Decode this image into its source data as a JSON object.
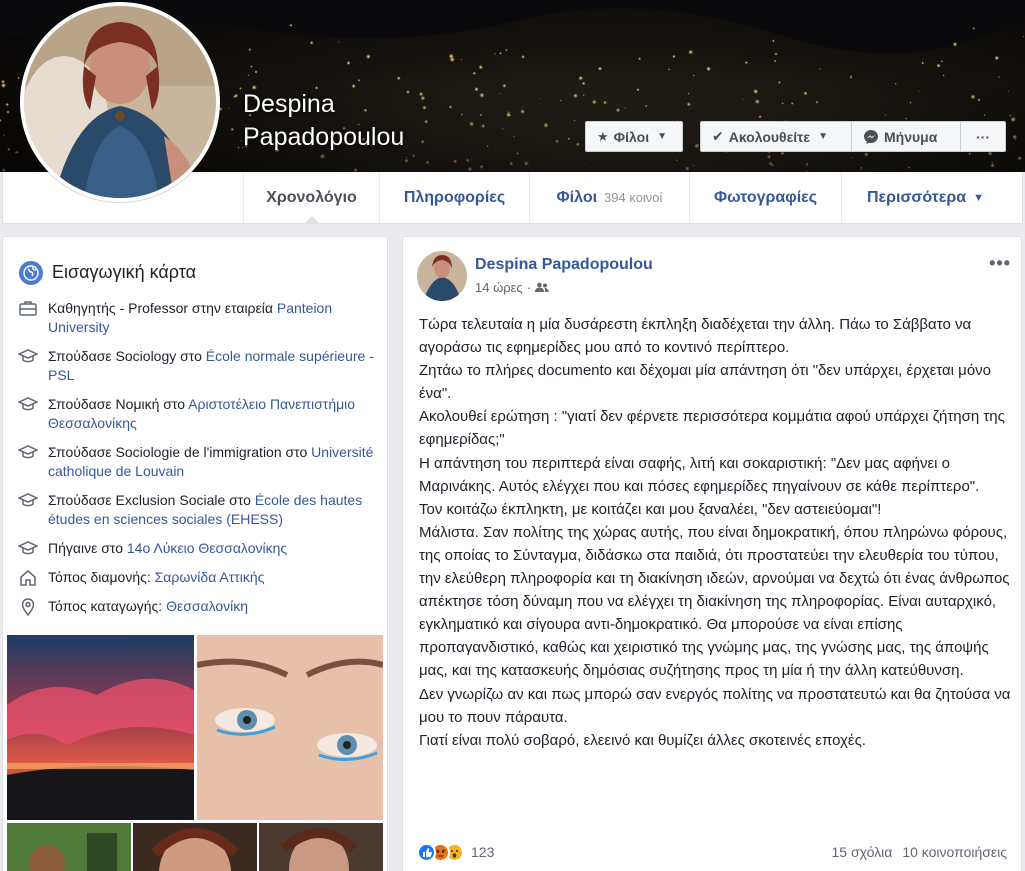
{
  "profile": {
    "name": "Despina Papadopoulou"
  },
  "cover_actions": {
    "friends_label": "Φίλοι",
    "follow_label": "Ακολουθείτε",
    "message_label": "Μήνυμα",
    "more_label": "···"
  },
  "nav": {
    "tabs": [
      {
        "label": "Χρονολόγιο"
      },
      {
        "label": "Πληροφορίες"
      },
      {
        "label": "Φίλοι",
        "count": "394 κοινοί"
      },
      {
        "label": "Φωτογραφίες"
      },
      {
        "label": "Περισσότερα"
      }
    ]
  },
  "intro": {
    "title": "Εισαγωγική κάρτα",
    "items": [
      {
        "icon": "briefcase-icon",
        "text": "Καθηγητής - Professor στην εταιρεία ",
        "link": "Panteion University"
      },
      {
        "icon": "graduation-cap-icon",
        "text": "Σπούδασε Sociology στο ",
        "link": "École normale supérieure - PSL"
      },
      {
        "icon": "graduation-cap-icon",
        "text": "Σπούδασε Νομική στο ",
        "link": "Αριστοτέλειο Πανεπιστήμιο Θεσσαλονίκης"
      },
      {
        "icon": "graduation-cap-icon",
        "text": "Σπούδασε Sociologie de l'immigration στο ",
        "link": "Université catholique de Louvain"
      },
      {
        "icon": "graduation-cap-icon",
        "text": "Σπούδασε Exclusion Sociale στο ",
        "link": "École des hautes études en sciences sociales (EHESS)"
      },
      {
        "icon": "graduation-cap-icon",
        "text": "Πήγαινε στο ",
        "link": "14ο Λύκειο Θεσσαλονίκης"
      },
      {
        "icon": "home-icon",
        "text": "Τόπος διαμονής: ",
        "link": "Σαρωνίδα Αττικής"
      },
      {
        "icon": "location-pin-icon",
        "text": "Τόπος καταγωγής: ",
        "link": "Θεσσαλονίκη"
      }
    ]
  },
  "post": {
    "author": "Despina Papadopoulou",
    "time": "14 ώρες",
    "audience_icon": "friends-icon",
    "paragraphs": [
      "Τώρα τελευταία η μία δυσάρεστη έκπληξη διαδέχεται την άλλη. Πάω το Σάββατο να αγοράσω τις εφημερίδες μου από το κοντινό περίπτερο.",
      "Ζητάω το πλήρες documento και δέχομαι μία απάντηση ότι \"δεν υπάρχει, έρχεται μόνο ένα\".",
      "Ακολουθεί ερώτηση : \"γιατί δεν φέρνετε περισσότερα κομμάτια αφού υπάρχει ζήτηση της εφημερίδας;\"",
      "Η απάντηση του περιπτερά είναι σαφής, λιτή και σοκαριστική: \"Δεν μας αφήνει ο Μαρινάκης. Αυτός ελέγχει που και πόσες εφημερίδες πηγαίνουν σε κάθε περίπτερο\".",
      "Τον κοιτάζω έκπληκτη, με κοιτάζει και μου ξαναλέει, \"δεν αστειεύομαι\"!",
      "Μάλιστα. Σαν πολίτης της χώρας αυτής, που είναι δημοκρατική, όπου πληρώνω φόρους, της οποίας το Σύνταγμα, διδάσκω στα παιδιά, ότι προστατεύει την ελευθερία του τύπου, την ελεύθερη πληροφορία και τη διακίνηση ιδεών, αρνούμαι να δεχτώ ότι ένας άνθρωπος απέκτησε τόση δύναμη που να ελέγχει τη διακίνηση της πληροφορίας. Είναι αυταρχικό, εγκληματικό και σίγουρα αντι-δημοκρατικό. Θα μπορούσε να είναι επίσης προπαγανδιστικό, καθώς και χειριστικό της γνώμης μας, της γνώσης μας, της άποψής μας, και της κατασκευής δημόσιας συζήτησης προς τη μία ή την άλλη κατεύθυνση.",
      "Δεν γνωρίζω αν και πως μπορώ σαν ενεργός πολίτης να προστατευτώ και θα ζητούσα να μου το πουν πάραυτα.",
      "Γιατί είναι πολύ σοβαρό, ελεεινό και θυμίζει άλλες σκοτεινές εποχές."
    ],
    "reactions": {
      "icons": [
        "like-icon",
        "angry-icon",
        "wow-icon"
      ],
      "count": "123"
    },
    "comments": "15 σχόλια",
    "shares": "10 κοινοποιήσεις",
    "menu_label": "•••"
  },
  "colors": {
    "link": "#365899",
    "like": "#1877f2",
    "angry": "#e9710f",
    "wow": "#f7b125"
  }
}
